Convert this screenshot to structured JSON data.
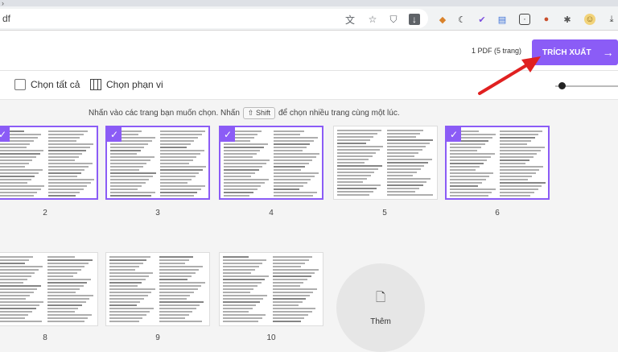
{
  "browser": {
    "url_fragment": "df",
    "omnibox_icons": [
      "translate-icon",
      "star-icon",
      "shield-icon",
      "download-icon"
    ],
    "extension_icons": [
      "extension-orange-icon",
      "moon-icon",
      "check-extension-icon",
      "document-extension-icon",
      "box-extension-icon",
      "colorful-extension-icon",
      "puzzle-icon",
      "avatar-icon",
      "download-arrow-icon"
    ]
  },
  "header": {
    "page_count": "1 PDF (5 trang)",
    "extract_label": "TRÍCH XUẤT",
    "extract_arrow": "→"
  },
  "toolbar": {
    "select_all": "Chọn tất cả",
    "select_range": "Chọn phạn vi"
  },
  "instruction": {
    "before": "Nhấn vào các trang bạn muốn chọn. Nhấn",
    "key": "⇧ Shift",
    "after": "để chọn nhiều trang cùng một lúc."
  },
  "pages": [
    {
      "number": "2",
      "selected": true
    },
    {
      "number": "3",
      "selected": true
    },
    {
      "number": "4",
      "selected": true
    },
    {
      "number": "5",
      "selected": false
    },
    {
      "number": "6",
      "selected": true
    },
    {
      "number": "8",
      "selected": false
    },
    {
      "number": "9",
      "selected": false
    },
    {
      "number": "10",
      "selected": false
    }
  ],
  "add_button": {
    "label": "Thêm",
    "icon": "add-file-icon"
  },
  "colors": {
    "accent": "#8b5cf6",
    "annotation_arrow": "#e02020"
  }
}
